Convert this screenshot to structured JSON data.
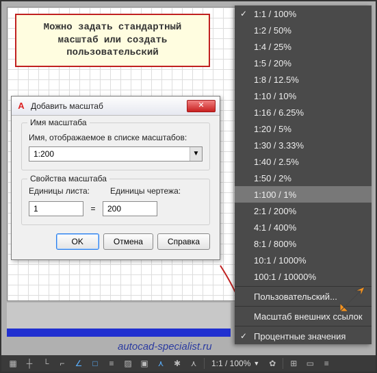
{
  "note": "Можно задать стандартный масштаб или создать пользовательский",
  "dialog": {
    "title": "Добавить масштаб",
    "group1": {
      "title": "Имя масштаба",
      "label": "Имя, отображаемое в списке масштабов:",
      "value": "1:200"
    },
    "group2": {
      "title": "Свойства масштаба",
      "paper_label": "Единицы листа:",
      "drawing_label": "Единицы чертежа:",
      "paper_value": "1",
      "drawing_value": "200"
    },
    "ok": "OK",
    "cancel": "Отмена",
    "help": "Справка"
  },
  "menu": {
    "items": [
      {
        "label": "1:1 / 100%",
        "checked": true
      },
      {
        "label": "1:2 / 50%"
      },
      {
        "label": "1:4 / 25%"
      },
      {
        "label": "1:5 / 20%"
      },
      {
        "label": "1:8 / 12.5%"
      },
      {
        "label": "1:10 / 10%"
      },
      {
        "label": "1:16 / 6.25%"
      },
      {
        "label": "1:20 / 5%"
      },
      {
        "label": "1:30 / 3.33%"
      },
      {
        "label": "1:40 / 2.5%"
      },
      {
        "label": "1:50 / 2%"
      },
      {
        "label": "1:100 / 1%",
        "selected": true
      },
      {
        "label": "2:1 / 200%"
      },
      {
        "label": "4:1 / 400%"
      },
      {
        "label": "8:1 / 800%"
      },
      {
        "label": "10:1 / 1000%"
      },
      {
        "label": "100:1 / 10000%"
      }
    ],
    "custom": "Пользовательский...",
    "xref": "Масштаб внешних ссылок",
    "percent": "Процентные значения",
    "percent_checked": true
  },
  "statusbar": {
    "scale": "1:1 / 100%"
  },
  "watermark": "autocad-specialist.ru"
}
